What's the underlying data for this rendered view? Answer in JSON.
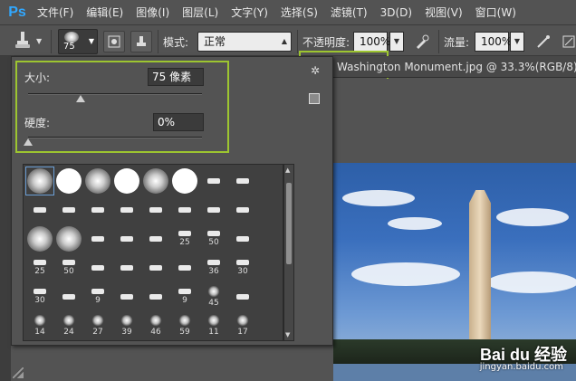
{
  "app": {
    "logo": "Ps"
  },
  "menu": [
    {
      "label": "文件(F)"
    },
    {
      "label": "编辑(E)"
    },
    {
      "label": "图像(I)"
    },
    {
      "label": "图层(L)"
    },
    {
      "label": "文字(Y)"
    },
    {
      "label": "选择(S)"
    },
    {
      "label": "滤镜(T)"
    },
    {
      "label": "3D(D)"
    },
    {
      "label": "视图(V)"
    },
    {
      "label": "窗口(W)"
    }
  ],
  "options": {
    "brush_size": "75",
    "mode_label": "模式:",
    "mode_value": "正常",
    "opacity_label": "不透明度:",
    "opacity_value": "100%",
    "flow_label": "流量:",
    "flow_value": "100%"
  },
  "document": {
    "tab_title": "Washington Monument.jpg @ 33.3%(RGB/8)"
  },
  "brush_panel": {
    "size_label": "大小:",
    "size_value": "75 像素",
    "hardness_label": "硬度:",
    "hardness_value": "0%",
    "size_slider": 0.3,
    "hardness_slider": 0.0,
    "presets": [
      {
        "type": "soft",
        "num": ""
      },
      {
        "type": "hard",
        "num": ""
      },
      {
        "type": "soft",
        "num": ""
      },
      {
        "type": "hard",
        "num": ""
      },
      {
        "type": "soft",
        "num": ""
      },
      {
        "type": "hard",
        "num": ""
      },
      {
        "type": "mark",
        "num": ""
      },
      {
        "type": "mark",
        "num": ""
      },
      {
        "type": "mark",
        "num": ""
      },
      {
        "type": "mark",
        "num": ""
      },
      {
        "type": "mark",
        "num": ""
      },
      {
        "type": "mark",
        "num": ""
      },
      {
        "type": "mark",
        "num": ""
      },
      {
        "type": "mark",
        "num": ""
      },
      {
        "type": "mark",
        "num": ""
      },
      {
        "type": "mark",
        "num": ""
      },
      {
        "type": "soft",
        "num": ""
      },
      {
        "type": "soft",
        "num": ""
      },
      {
        "type": "mark",
        "num": ""
      },
      {
        "type": "mark",
        "num": ""
      },
      {
        "type": "mark",
        "num": ""
      },
      {
        "type": "mark",
        "num": "25"
      },
      {
        "type": "mark",
        "num": "50"
      },
      {
        "type": "mark",
        "num": ""
      },
      {
        "type": "mark",
        "num": "25"
      },
      {
        "type": "mark",
        "num": "50"
      },
      {
        "type": "mark",
        "num": ""
      },
      {
        "type": "mark",
        "num": ""
      },
      {
        "type": "mark",
        "num": ""
      },
      {
        "type": "mark",
        "num": ""
      },
      {
        "type": "mark",
        "num": "36"
      },
      {
        "type": "mark",
        "num": "30"
      },
      {
        "type": "mark",
        "num": "30"
      },
      {
        "type": "mark",
        "num": ""
      },
      {
        "type": "mark",
        "num": "9"
      },
      {
        "type": "mark",
        "num": ""
      },
      {
        "type": "mark",
        "num": ""
      },
      {
        "type": "mark",
        "num": "9"
      },
      {
        "type": "splat",
        "num": "45"
      },
      {
        "type": "mark",
        "num": ""
      },
      {
        "type": "splat",
        "num": "14"
      },
      {
        "type": "splat",
        "num": "24"
      },
      {
        "type": "splat",
        "num": "27"
      },
      {
        "type": "splat",
        "num": "39"
      },
      {
        "type": "splat",
        "num": "46"
      },
      {
        "type": "splat",
        "num": "59"
      },
      {
        "type": "splat",
        "num": "11"
      },
      {
        "type": "splat",
        "num": "17"
      }
    ]
  },
  "watermark": {
    "brand": "Bai du 经验",
    "url": "jingyan.baidu.com"
  },
  "colors": {
    "highlight": "#9dc530",
    "selection": "#6c9fd6"
  }
}
